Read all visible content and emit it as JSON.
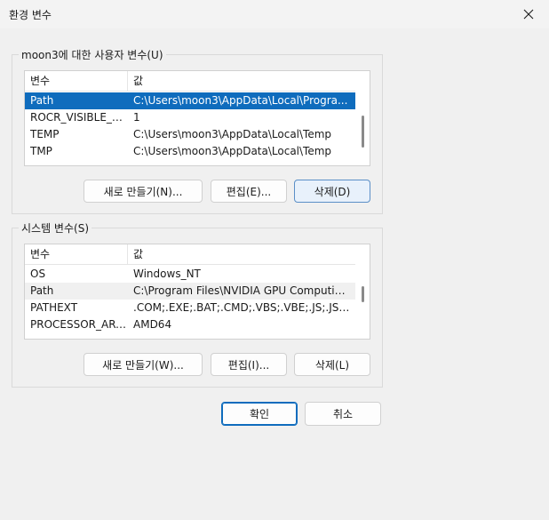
{
  "window": {
    "title": "환경 변수"
  },
  "user_section": {
    "label": "moon3에 대한 사용자 변수(U)",
    "columns": [
      "변수",
      "값"
    ],
    "rows": [
      {
        "name": "Path",
        "value": "C:\\Users\\moon3\\AppData\\Local\\Progra..."
      },
      {
        "name": "ROCR_VISIBLE_DE...",
        "value": "1"
      },
      {
        "name": "TEMP",
        "value": "C:\\Users\\moon3\\AppData\\Local\\Temp"
      },
      {
        "name": "TMP",
        "value": "C:\\Users\\moon3\\AppData\\Local\\Temp"
      }
    ],
    "buttons": {
      "new": "새로 만들기(N)...",
      "edit": "편집(E)...",
      "delete": "삭제(D)"
    }
  },
  "system_section": {
    "label": "시스템 변수(S)",
    "columns": [
      "변수",
      "값"
    ],
    "rows": [
      {
        "name": "OS",
        "value": "Windows_NT"
      },
      {
        "name": "Path",
        "value": "C:\\Program Files\\NVIDIA GPU Computing..."
      },
      {
        "name": "PATHEXT",
        "value": ".COM;.EXE;.BAT;.CMD;.VBS;.VBE;.JS;.JSE;.W..."
      },
      {
        "name": "PROCESSOR_ARC...",
        "value": "AMD64"
      }
    ],
    "buttons": {
      "new": "새로 만들기(W)...",
      "edit": "편집(I)...",
      "delete": "삭제(L)"
    }
  },
  "footer": {
    "ok": "확인",
    "cancel": "취소"
  },
  "colors": {
    "selection": "#0f6cbd",
    "background": "#f0f0f0"
  }
}
